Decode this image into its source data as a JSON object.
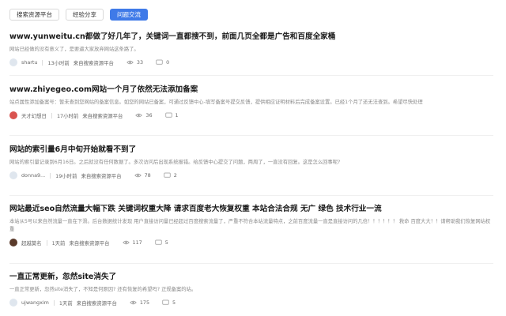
{
  "tabs": [
    {
      "label": "搜索资源平台",
      "active": false
    },
    {
      "label": "经验分享",
      "active": false
    },
    {
      "label": "问题交流",
      "active": true
    }
  ],
  "posts": [
    {
      "title": "www.yunweitu.cn都做了好几年了，关键词一直都搜不到，前面几页全都是广告和百度全家桶",
      "excerpt": "网站已经做的没有意义了，是要逼大家放弃网站这条路了。",
      "user": "shartu",
      "time": "13小时前",
      "source": "来自搜索资源平台",
      "views": "33",
      "comments": "0",
      "avatar_color": "#dfe6ee"
    },
    {
      "title": "www.zhiyegeo.com网站一个月了依然无法添加备案",
      "excerpt": "站点属性添加备案号：暂未查到您网站的备案信息。如您的网站已备案，可通过反馈中心-填写备案号提交反馈，提供相应证明材料后完成备案设置。已经1个月了还无法查到。希望尽快处理",
      "user": "天才幻想日",
      "time": "17小时前",
      "source": "来自搜索资源平台",
      "views": "36",
      "comments": "1",
      "avatar_color": "#d9534f"
    },
    {
      "title": "网站的索引量6月中旬开始就看不到了",
      "excerpt": "网站的索引量记录到6月16日。之后就没有任何数据了。多次访问后出现系统报错。给反馈中心提交了问题，两周了，一直没有回复。这是怎么回事呢?",
      "user": "donna9...",
      "time": "19小时前",
      "source": "来自搜索资源平台",
      "views": "78",
      "comments": "2",
      "avatar_color": "#dfe6ee"
    },
    {
      "title": "网站最近seo自然流量大幅下跌 关键词权重大降 请求百度老大恢复权重 本站合法合规 无广 绿色 技术行业一流",
      "excerpt": "本站从5号以来自然流量一直在下滑。后台数据统计发现 用户直接访问量已经超过百度搜索流量了，严重不符合本站流量特点，之前百度流量一直是直接访问的几倍！！！！！！  救命 百度大大！！请帮助我们恢复网站权重",
      "user": "超越莫名",
      "time": "1天前",
      "source": "来自搜索资源平台",
      "views": "117",
      "comments": "5",
      "avatar_color": "#5a3a2a"
    },
    {
      "title": "一直正常更新，忽然site消失了",
      "excerpt": "一直正常更新，忽然site消失了，不知是何原因? 还有恢复的希望吗? 正规备案的站。",
      "user": "ujwangxim",
      "time": "1天前",
      "source": "来自搜索资源平台",
      "views": "175",
      "comments": "5",
      "avatar_color": "#dfe6ee"
    }
  ]
}
